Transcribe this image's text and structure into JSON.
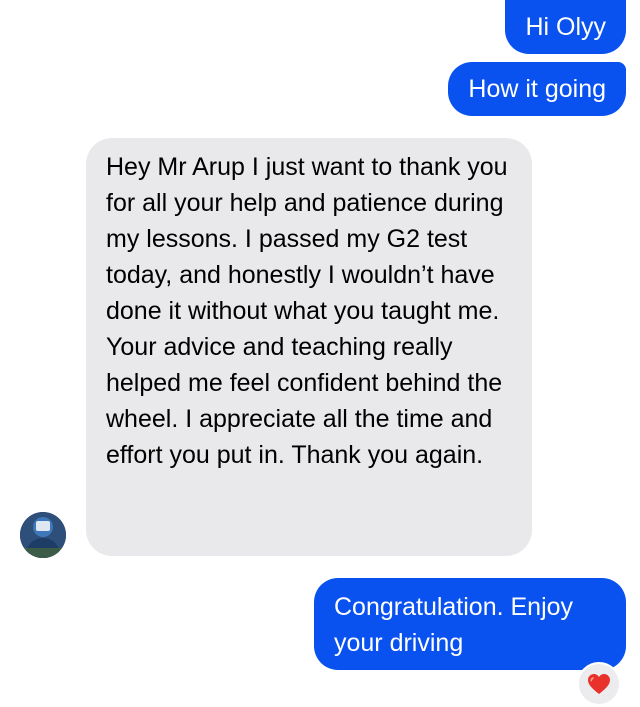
{
  "conversation": {
    "outgoing": [
      {
        "text": "Hi Olyy"
      },
      {
        "text": "How it going"
      },
      {
        "text": "Congratulation. Enjoy your driving"
      }
    ],
    "incoming": [
      {
        "text": "Hey Mr Arup I just want to thank you for all your help and patience during my lessons. I passed my G2 test today, and honestly I wouldn’t have done it without what you taught me. Your advice and teaching really helped me feel confident behind the wheel. I appreciate all the time and effort you put in. Thank you again."
      }
    ],
    "reaction": {
      "icon": "heart-icon",
      "color": "#e8312a"
    }
  },
  "colors": {
    "outgoing_bubble": "#0a52f0",
    "incoming_bubble": "#e9e9eb"
  }
}
